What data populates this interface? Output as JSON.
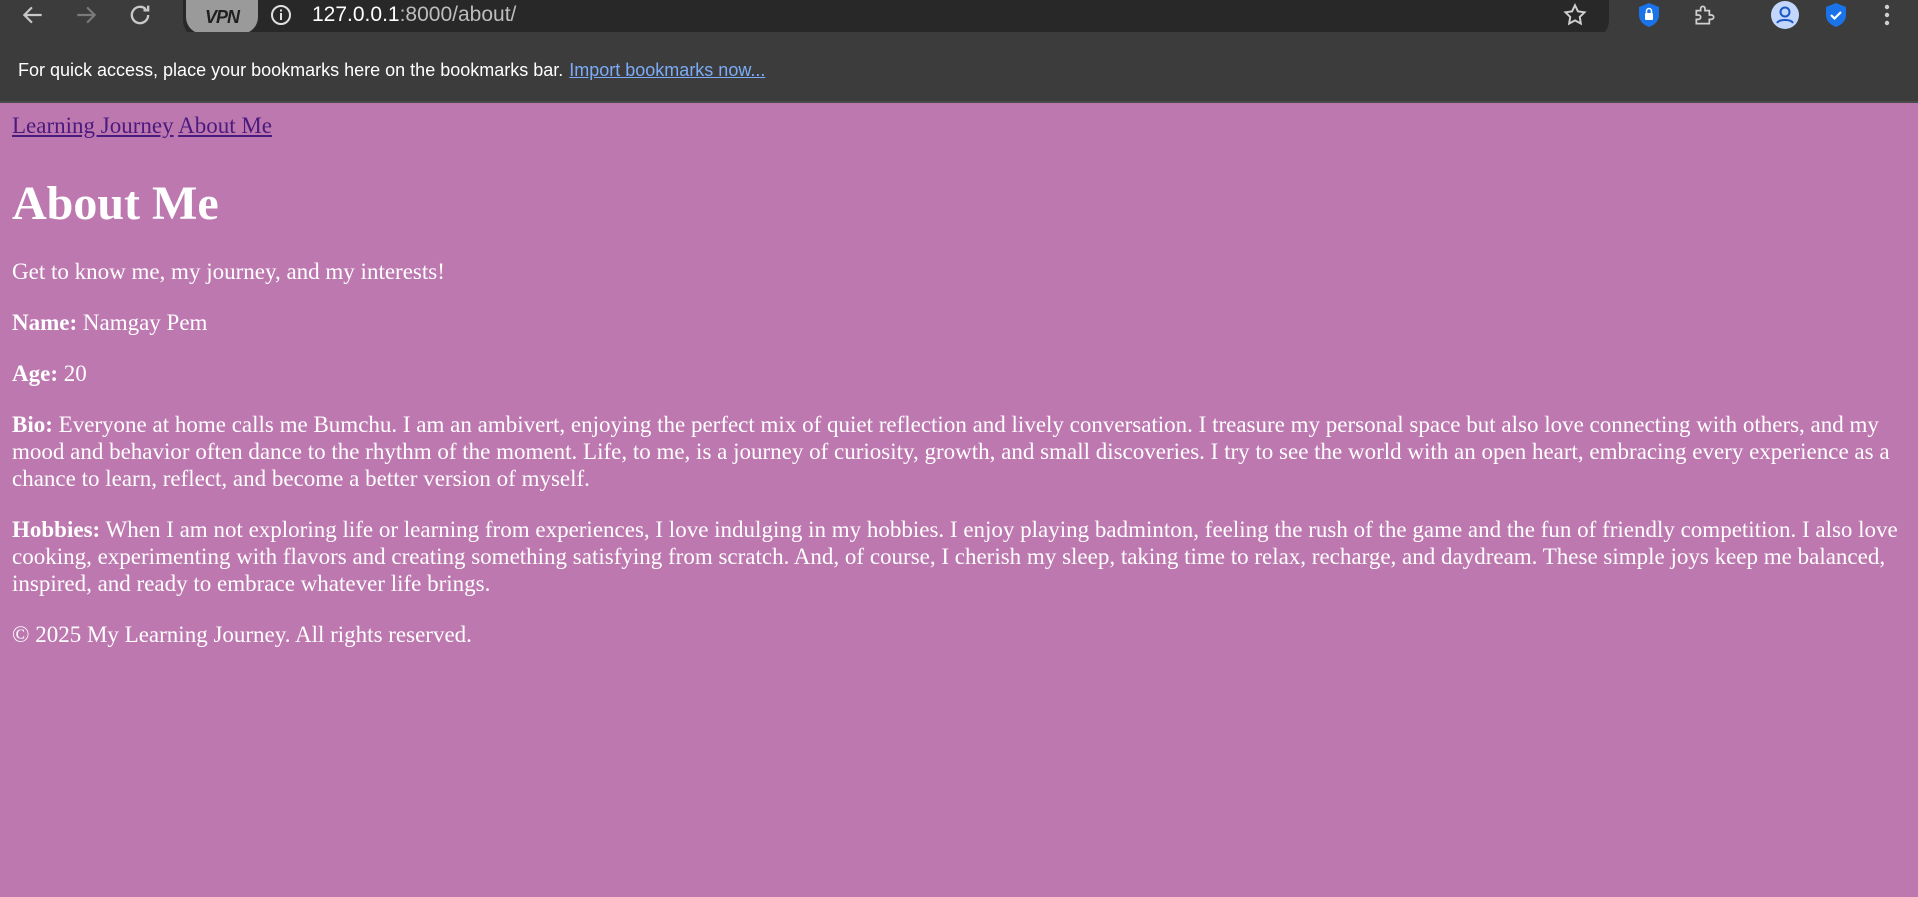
{
  "browser": {
    "vpn_label": "VPN",
    "url_host": "127.0.0.1",
    "url_rest": ":8000/about/",
    "bookmarks_prompt": "For quick access, place your bookmarks here on the bookmarks bar.",
    "import_link": "Import bookmarks now..."
  },
  "icons": {
    "back": "back-arrow-icon",
    "forward": "forward-arrow-icon",
    "reload": "reload-icon",
    "info": "info-icon",
    "star": "star-icon",
    "password": "password-manager-icon",
    "extensions": "puzzle-icon",
    "profile": "profile-icon",
    "shield": "shield-check-icon",
    "menu": "kebab-menu-icon"
  },
  "colors": {
    "page_background": "#bd78b0",
    "link": "#4b1a7e",
    "chrome_toolbar": "#3c3c3c"
  },
  "site": {
    "nav": [
      {
        "label": "Learning Journey"
      },
      {
        "label": "About Me"
      }
    ],
    "title": "About Me",
    "intro": "Get to know me, my journey, and my interests!",
    "name_label": "Name:",
    "name_value": " Namgay Pem",
    "age_label": "Age:",
    "age_value": " 20",
    "bio_label": "Bio:",
    "bio_value": " Everyone at home calls me Bumchu. I am an ambivert, enjoying the perfect mix of quiet reflection and lively conversation. I treasure my personal space but also love connecting with others, and my mood and behavior often dance to the rhythm of the moment. Life, to me, is a journey of curiosity, growth, and small discoveries. I try to see the world with an open heart, embracing every experience as a chance to learn, reflect, and become a better version of myself.",
    "hobbies_label": "Hobbies:",
    "hobbies_value": " When I am not exploring life or learning from experiences, I love indulging in my hobbies. I enjoy playing badminton, feeling the rush of the game and the fun of friendly competition. I also love cooking, experimenting with flavors and creating something satisfying from scratch. And, of course, I cherish my sleep, taking time to relax, recharge, and daydream. These simple joys keep me balanced, inspired, and ready to embrace whatever life brings.",
    "footer": "© 2025 My Learning Journey. All rights reserved."
  }
}
